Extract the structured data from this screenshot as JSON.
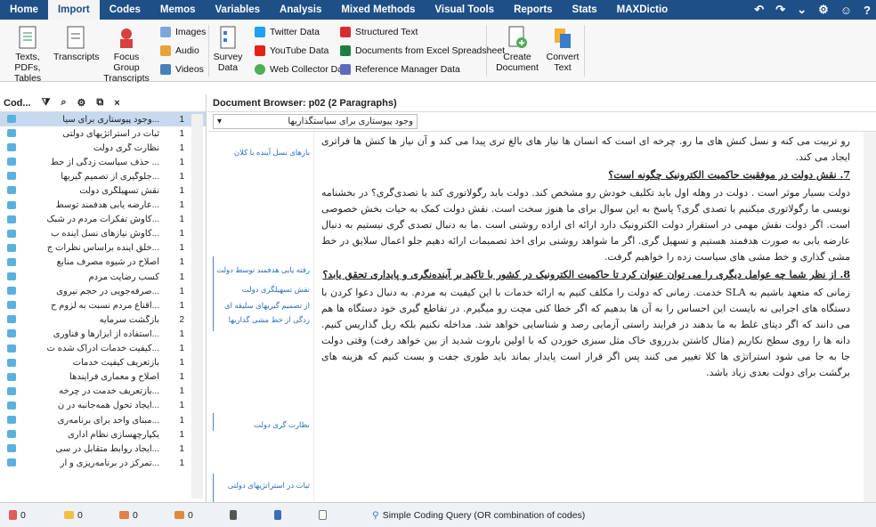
{
  "menubar": {
    "items": [
      "Home",
      "Import",
      "Codes",
      "Memos",
      "Variables",
      "Analysis",
      "Mixed Methods",
      "Visual Tools",
      "Reports",
      "Stats",
      "MAXDictio"
    ],
    "active": "Import"
  },
  "ribbon": {
    "texts_pdfs": "Texts, PDFs, Tables",
    "transcripts": "Transcripts",
    "focus_group": "Focus Group Transcripts",
    "images": "Images",
    "audio": "Audio",
    "videos": "Videos",
    "survey_data": "Survey Data",
    "twitter_data": "Twitter Data",
    "youtube_data": "YouTube Data",
    "web_collector": "Web Collector Data",
    "structured_text": "Structured Text",
    "excel_docs": "Documents from Excel Spreadsheet",
    "reference_manager": "Reference Manager Data",
    "create_document": "Create Document",
    "convert_text": "Convert Text"
  },
  "left_panel": {
    "title": "Cod...",
    "codes": [
      {
        "name": "...وجود پیوستاری برای سیا",
        "count": "1"
      },
      {
        "name": "ثبات در استراتژیهای دولتی",
        "count": "1"
      },
      {
        "name": "نظارت گری دولت",
        "count": "1"
      },
      {
        "name": "... حذف سیاست زدگی از حط",
        "count": "1"
      },
      {
        "name": "...جلوگیری از تصمیم گیریها",
        "count": "1"
      },
      {
        "name": "نقش تسهیلگری دولت",
        "count": "1"
      },
      {
        "name": "...عارضه یابی هدفمند توسط",
        "count": "1"
      },
      {
        "name": "...کاوش تفکرات مردم در شبک",
        "count": "1"
      },
      {
        "name": "...کاوش نیازهای نسل آینده ب",
        "count": "1"
      },
      {
        "name": "...خلق آینده براساس نظرات ج",
        "count": "1"
      },
      {
        "name": "اصلاح در شیوه مصرف منابع",
        "count": "1"
      },
      {
        "name": "کسب رضایت مردم",
        "count": "1"
      },
      {
        "name": "...صرفه‌جویی در حجم نیروی",
        "count": "1"
      },
      {
        "name": "...اقناع مردم نسبت به لزوم ح",
        "count": "1"
      },
      {
        "name": "بازگشت سرمایه",
        "count": "2"
      },
      {
        "name": "...استفاده از ابزارها و فناوری",
        "count": "1"
      },
      {
        "name": "...کیفیت خدمات ادراک شده ت",
        "count": "1"
      },
      {
        "name": "بازتعریف کیفیت خدمات",
        "count": "1"
      },
      {
        "name": "اصلاح و معماری فرایندها",
        "count": "1"
      },
      {
        "name": "...بازتعریف خدمت در چرخه",
        "count": "1"
      },
      {
        "name": "...ایجاد تحول همه‌جانبه در ن",
        "count": "1"
      },
      {
        "name": "...مبنای واحد برای برنامه‌ری",
        "count": "1"
      },
      {
        "name": "یکپارچهسازی نظام اداری",
        "count": "1"
      },
      {
        "name": "...ایجاد روابط متقابل در سی",
        "count": "1"
      },
      {
        "name": "...تمرکز در برنامه‌ریزی و ار",
        "count": "1"
      }
    ]
  },
  "document": {
    "title": "Document Browser: p02  (2 Paragraphs)",
    "paragraph_selector": "وجود پیوستاری برای سیاستگذاریها",
    "margin_memos": [
      "بازهای نسل آینده با کلان",
      "رفته یابی هدفمند توسط دولت",
      "نقش تسهیلگری دولت",
      "از تصمیم گیریهای سلیقه ای",
      "زدگی از خط مشی گذاریها",
      "نظارت گری دولت",
      "ثبات در استراتژیهای دولتی"
    ],
    "paragraphs": [
      {
        "type": "text",
        "text": "رو تربیت می کنه و نسل کنش های ما رو. چرخه ای است که انسان ها نیاز های بالغ تری پیدا می کند و آن نیاز ها کنش ها فراتری ایجاد می کند."
      },
      {
        "type": "heading",
        "text": "7. نقش دولت در موفقیت حاکمیت الکترونیک چگونه است؟"
      },
      {
        "type": "text",
        "text": "دولت بسیار موثر است . دولت در وهله اول باید تکلیف خودش رو مشخص کند. دولت باید رگولاتوری کند یا تصدی‌گری؟ در بخشنامه نویسی ما رگولاتوری میکنیم یا تصدی گری؟ پاسخ به این سوال برای ما هنوز سخت است. نقش دولت کمک به حیات بخش خصوصی است. اگر دولت نقش مهمی در استقرار دولت الکترونیک دارد ارائه ای اراده روشنی است .ما به دنبال تصدی گری نیستیم به دنبال عارضه یابی به صورت هدفمند هستیم و تسهیل گری. اگر ما شواهد روشنی برای اخذ تصمیمات ارائه دهیم جلو اعمال سلایق در خط مشی گذاری و خط مشی های سیاست زده را خواهیم گرفت."
      },
      {
        "type": "heading",
        "text": "8. از نظر شما چه عوامل دیگری را می توان عنوان کرد تا حاکمیت الکترونیک در کشور با تاکید بر آینده‌نگری و پایداری تحقق یابد؟"
      },
      {
        "type": "text",
        "text": "زمانی که متعهد باشیم به SLA خدمت. زمانی که دولت را مکلف کنیم به ارائه خدمات با این کیفیت به مردم. به دنبال دعوا کردن با دستگاه های اجرایی نه بایست این احساس را به آن ها بدهیم که اگر خطا کنی مچت رو میگیرم. در تقاطع گیری خود دستگاه ها هم می دانند که اگر دیتای غلط به ما بدهند در فرایند راستی آزمایی رصد و شناسایی خواهد شد. مداخله نکنیم بلکه ریل گذاریس کنیم. دانه ها را روی سطح نکاریم (مثال کاشتن بذرروی خاک مثل سبزی خوردن که با اولین باروت شدید از بین خواهد رفت) وقتی دولت جا به جا می شود استراتژی ها کلا تغییر می کنند پس اگر قرار است پایدار بماند باید طوری جفت و بست کنیم که هزینه های برگشت برای دولت بعدی زیاد باشد."
      }
    ]
  },
  "status": {
    "documents": "0",
    "memos": "0",
    "coded": "0",
    "variables": "0",
    "query_label": "Simple Coding Query (OR combination of codes)"
  },
  "colors": {
    "menubar": "#1e4f86",
    "selection": "#c6d9ee",
    "code_tag": "#5bb0de",
    "memo_blue": "#2d6fb5"
  }
}
